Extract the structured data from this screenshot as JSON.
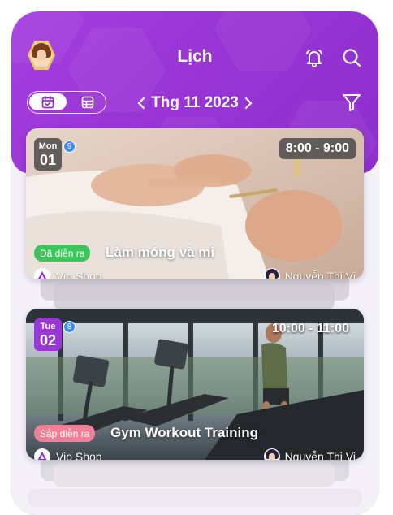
{
  "header": {
    "title": "Lịch",
    "month_label": "Thg 11 2023",
    "icons": [
      "user-avatar",
      "bell-icon",
      "search-icon",
      "calendar-view-icon",
      "grid-view-icon",
      "chevron-left-icon",
      "chevron-right-icon",
      "filter-icon"
    ]
  },
  "colors": {
    "brand": "#9a35d6",
    "done_status": "#3cc55a",
    "upcoming_status": "#f07f98",
    "count_badge": "#3c8cf2"
  },
  "events": [
    {
      "day_of_week": "Mon",
      "day": "01",
      "count": "9",
      "time": "8:00 - 9:00",
      "status": "Đã diễn ra",
      "title": "Làm móng và mi",
      "shop": "Vio Shop",
      "person": "Nguyễn Thị Vi"
    },
    {
      "day_of_week": "Tue",
      "day": "02",
      "count": "8",
      "time": "10:00 - 11:00",
      "status": "Sắp diễn ra",
      "title": "Gym Workout Training",
      "shop": "Vio Shop",
      "person": "Nguyễn Thị Vi"
    }
  ]
}
